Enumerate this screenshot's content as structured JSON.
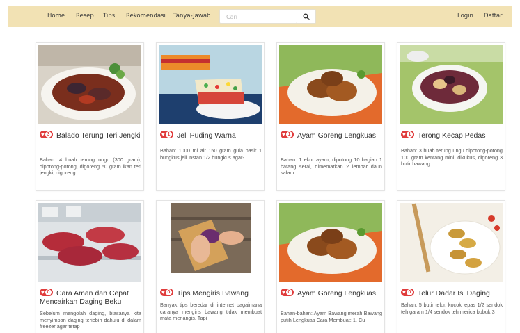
{
  "nav": {
    "links": [
      "Home",
      "Resep",
      "Tips",
      "Rekomendasi",
      "Tanya-Jawab"
    ],
    "search_placeholder": "Cari",
    "login": "Login",
    "register": "Daftar"
  },
  "cards": [
    {
      "likes": "3",
      "title": "Balado Terung Teri Jengki",
      "desc": "Bahan: 4 buah terung ungu (300 gram), dipotong-potong, digoreng 50 gram ikan teri jengki, digoreng"
    },
    {
      "likes": "1",
      "title": "Jeli Puding Warna",
      "desc": "Bahan: 1000 ml air 150 gram gula pasir 1 bungkus jeli instan 1/2 bungkus agar-"
    },
    {
      "likes": "1",
      "title": "Ayam Goreng Lengkuas",
      "desc": "Bahan: 1 ekor ayam, dipotong 10 bagian 1 batang serai, dimemarkan 2 lembar daun salam"
    },
    {
      "likes": "1",
      "title": "Terong Kecap Pedas",
      "desc": "Bahan: 3 buah terung ungu dipotong-potong 100 gram kentang mini, dikukus, digoreng 3 butir bawang"
    },
    {
      "likes": "0",
      "title": "Cara Aman dan Cepat Mencairkan Daging Beku",
      "desc": "Sebelum mengolah daging, biasanya kita menyimpan daging teriebih dahulu di dalam freezer agar tetap"
    },
    {
      "likes": "0",
      "title": "Tips Mengiris Bawang",
      "desc": "Banyak tips beredar di internet bagaimana caranya mengiris bawang tidak membuat mata menangis. Tapi"
    },
    {
      "likes": "0",
      "title": "Ayam Goreng Lengkuas",
      "desc": "Bahan-bahan: Ayam Bawang merah Bawang putih Lengkuas Cara Membuat: 1. Cu"
    },
    {
      "likes": "0",
      "title": "Telur Dadar Isi Daging",
      "desc": "Bahan: 5 butir telur, kocok lepas 1/2 sendok teh garam 1/4 sendok teh merica bubuk 3"
    }
  ],
  "icons": {
    "search": "magnifier-icon",
    "likes": "heart-icon"
  },
  "colors": {
    "navbar": "#f2e2b4",
    "like_badge": "#e03c3c"
  }
}
